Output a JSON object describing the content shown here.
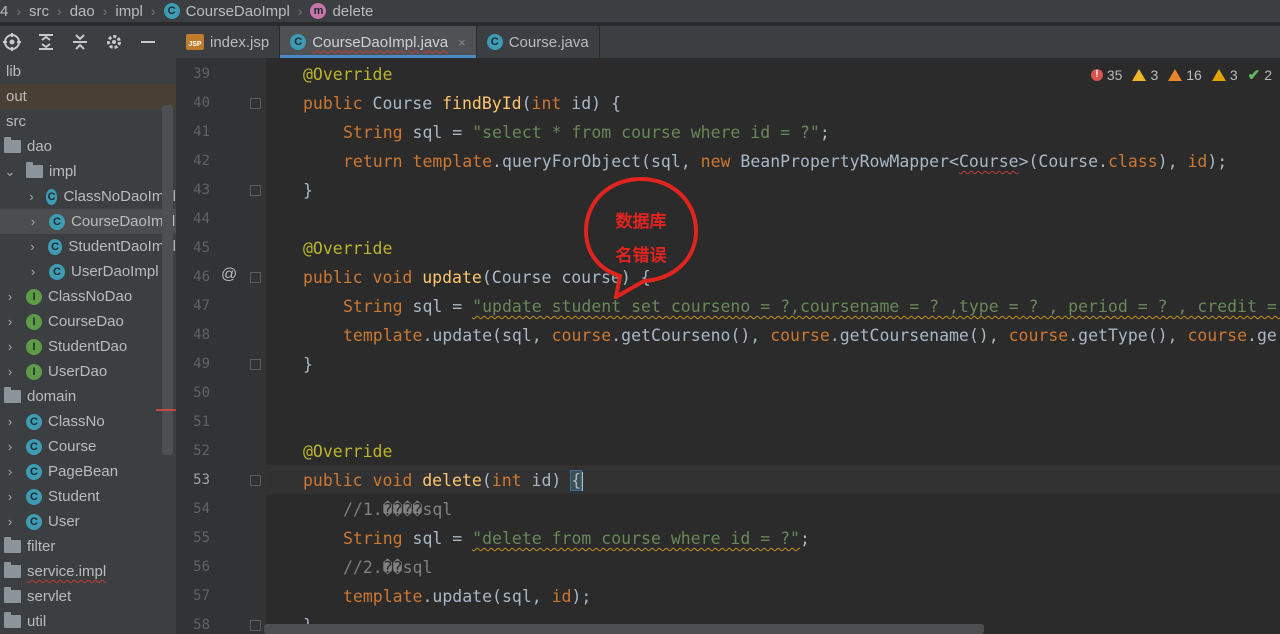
{
  "breadcrumb": {
    "items": [
      {
        "label": "4"
      },
      {
        "label": "src"
      },
      {
        "label": "dao"
      },
      {
        "label": "impl"
      },
      {
        "label": "CourseDaoImpl",
        "icon": "class-icon"
      },
      {
        "label": "delete",
        "icon": "method-icon"
      }
    ]
  },
  "tabs": [
    {
      "label": "index.jsp",
      "icon": "jsp-file-icon",
      "active": false
    },
    {
      "label": "CourseDaoImpl.java",
      "icon": "class-icon",
      "active": true,
      "close": "×"
    },
    {
      "label": "Course.java",
      "icon": "class-icon",
      "active": false
    }
  ],
  "tree": {
    "items": [
      {
        "label": "lib",
        "kind": "plain",
        "indent": 0
      },
      {
        "label": "out",
        "kind": "plain",
        "indent": 0,
        "highlight": true
      },
      {
        "label": "src",
        "kind": "plain",
        "indent": 0
      },
      {
        "label": "dao",
        "kind": "folder",
        "indent": 0
      },
      {
        "label": "impl",
        "kind": "folder",
        "indent": 1,
        "arrow": "⌄"
      },
      {
        "label": "ClassNoDaoImpl",
        "kind": "class",
        "indent": 2,
        "arrow": "›"
      },
      {
        "label": "CourseDaoImpl",
        "kind": "class",
        "indent": 2,
        "arrow": "›",
        "selected": true
      },
      {
        "label": "StudentDaoImpl",
        "kind": "class",
        "indent": 2,
        "arrow": "›"
      },
      {
        "label": "UserDaoImpl",
        "kind": "class",
        "indent": 2,
        "arrow": "›"
      },
      {
        "label": "ClassNoDao",
        "kind": "interface",
        "indent": 1,
        "arrow": "›"
      },
      {
        "label": "CourseDao",
        "kind": "interface",
        "indent": 1,
        "arrow": "›"
      },
      {
        "label": "StudentDao",
        "kind": "interface",
        "indent": 1,
        "arrow": "›"
      },
      {
        "label": "UserDao",
        "kind": "interface",
        "indent": 1,
        "arrow": "›"
      },
      {
        "label": "domain",
        "kind": "folder",
        "indent": 0
      },
      {
        "label": "ClassNo",
        "kind": "class",
        "indent": 1,
        "arrow": "›"
      },
      {
        "label": "Course",
        "kind": "class",
        "indent": 1,
        "arrow": "›"
      },
      {
        "label": "PageBean",
        "kind": "class",
        "indent": 1,
        "arrow": "›"
      },
      {
        "label": "Student",
        "kind": "class",
        "indent": 1,
        "arrow": "›"
      },
      {
        "label": "User",
        "kind": "class",
        "indent": 1,
        "arrow": "›"
      },
      {
        "label": "filter",
        "kind": "folder",
        "indent": 0
      },
      {
        "label": "service.impl",
        "kind": "folder",
        "indent": 0
      },
      {
        "label": "servlet",
        "kind": "folder",
        "indent": 0
      },
      {
        "label": "util",
        "kind": "folder",
        "indent": 0
      }
    ]
  },
  "inspections": {
    "errors": "35",
    "warnings": "3",
    "weak_warnings": "16",
    "typos": "3",
    "ok": "2"
  },
  "editor": {
    "current_line": 53,
    "lines": [
      {
        "n": "39"
      },
      {
        "n": "40"
      },
      {
        "n": "41"
      },
      {
        "n": "42"
      },
      {
        "n": "43"
      },
      {
        "n": "44"
      },
      {
        "n": "45"
      },
      {
        "n": "46"
      },
      {
        "n": "47"
      },
      {
        "n": "48"
      },
      {
        "n": "49"
      },
      {
        "n": "50"
      },
      {
        "n": "51"
      },
      {
        "n": "52"
      },
      {
        "n": "53"
      },
      {
        "n": "54"
      },
      {
        "n": "55"
      },
      {
        "n": "56"
      },
      {
        "n": "57"
      },
      {
        "n": "58"
      }
    ],
    "code": {
      "l39_ann": "@Override",
      "l40_a": "public",
      "l40_b": "Course",
      "l40_c": "findById",
      "l40_d": "(",
      "l40_e": "int",
      "l40_f": " id) {",
      "l41_a": "String",
      "l41_b": " sql = ",
      "l41_c": "\"select * from course where id = ?\"",
      "l41_d": ";",
      "l42_a": "return",
      "l42_b": "template",
      "l42_c": ".queryForObject(sql, ",
      "l42_d": "new",
      "l42_e": " BeanPropertyRowMapper<",
      "l42_f": "Course",
      "l42_g": ">(Course.",
      "l42_h": "class",
      "l42_i": "), ",
      "l42_j": "id",
      "l42_k": ");",
      "l43": "}",
      "l45_ann": "@Override",
      "l46_a": "public",
      "l46_b": "void",
      "l46_c": "update",
      "l46_d": "(Course course) {",
      "l47_a": "String",
      "l47_b": " sql = ",
      "l47_c": "\"update student set courseno = ?,coursename = ? ,type = ? , period = ? , credit = ",
      "l48_a": "template",
      "l48_b": ".update(sql, ",
      "l48_c": "course",
      "l48_d": ".getCourseno(), ",
      "l48_e": "course",
      "l48_f": ".getCoursename(), ",
      "l48_g": "course",
      "l48_h": ".getType(), ",
      "l48_i": "course",
      "l48_j": ".ge",
      "l49": "}",
      "l52_ann": "@Override",
      "l53_a": "public",
      "l53_b": "void",
      "l53_c": "delete",
      "l53_d": "(",
      "l53_e": "int",
      "l53_f": " id) ",
      "l53_g": "{",
      "l54": "//1.\u0000\u0000\u0000\u0000sql",
      "l55_a": "String",
      "l55_b": " sql = ",
      "l55_c": "\"delete from course where id = ?\"",
      "l55_d": ";",
      "l56": "//2.\u0000\u0000sql",
      "l57_a": "template",
      "l57_b": ".update(sql, ",
      "l57_c": "id",
      "l57_d": ");",
      "l58": "}",
      "at_marker": "@"
    }
  },
  "annotation": {
    "line1": "数据库",
    "line2": "名错误",
    "color": "#e0241f"
  }
}
